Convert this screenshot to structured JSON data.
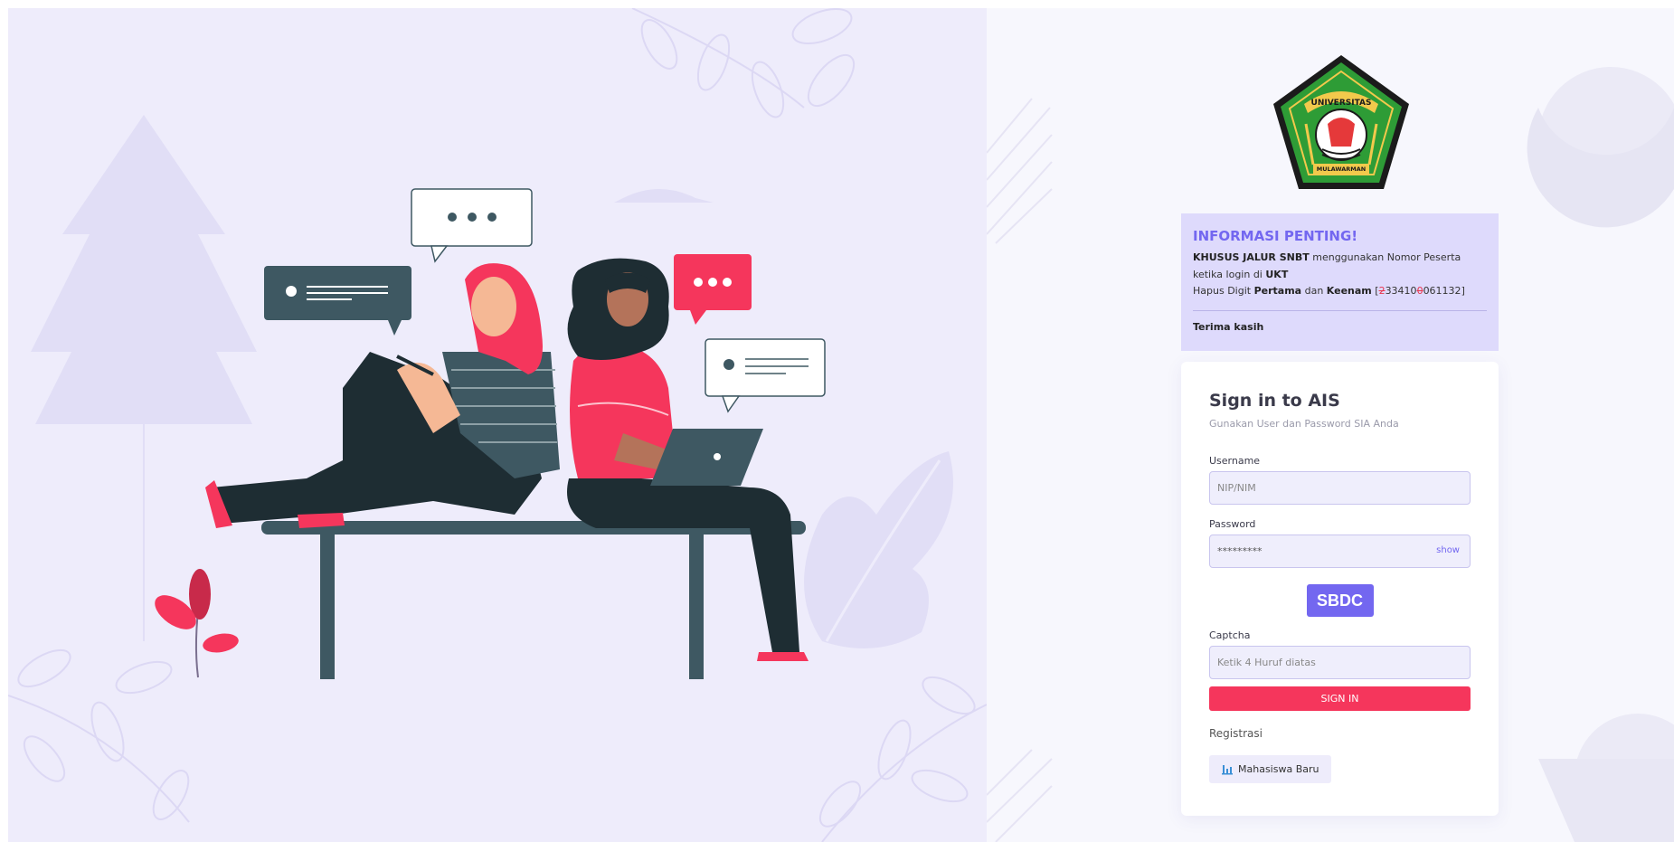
{
  "info": {
    "title": "INFORMASI PENTING!",
    "line1_bold": "KHUSUS JALUR SNBT",
    "line1_rest": " menggunakan Nomor Peserta",
    "line2_prefix": "ketika login di ",
    "line2_bold": "UKT",
    "line3_prefix": "Hapus Digit ",
    "line3_bold1": "Pertama",
    "line3_mid": " dan ",
    "line3_bold2": "Keenam",
    "line3_open": " [",
    "line3_strike1": "2",
    "line3_mid_digits": "33410",
    "line3_strike2": "0",
    "line3_end_digits": "061132",
    "line3_close": "]",
    "thanks": "Terima kasih"
  },
  "signin": {
    "title": "Sign in to AIS",
    "subtitle": "Gunakan User dan Password SIA Anda",
    "username_label": "Username",
    "username_placeholder": "NIP/NIM",
    "password_label": "Password",
    "password_value": "*********",
    "show_label": "show",
    "captcha_code": "SBDC",
    "captcha_label": "Captcha",
    "captcha_placeholder": "Ketik 4 Huruf diatas",
    "button_label": "SIGN IN"
  },
  "registration": {
    "title": "Registrasi",
    "new_student_label": "Mahasiswa Baru"
  },
  "logo": {
    "top_text": "UNIVERSITAS",
    "bottom_text": "MULAWARMAN"
  },
  "colors": {
    "accent": "#7367f0",
    "danger": "#f5365c",
    "info_bg": "#dedafc",
    "left_bg": "#eeecfb"
  }
}
